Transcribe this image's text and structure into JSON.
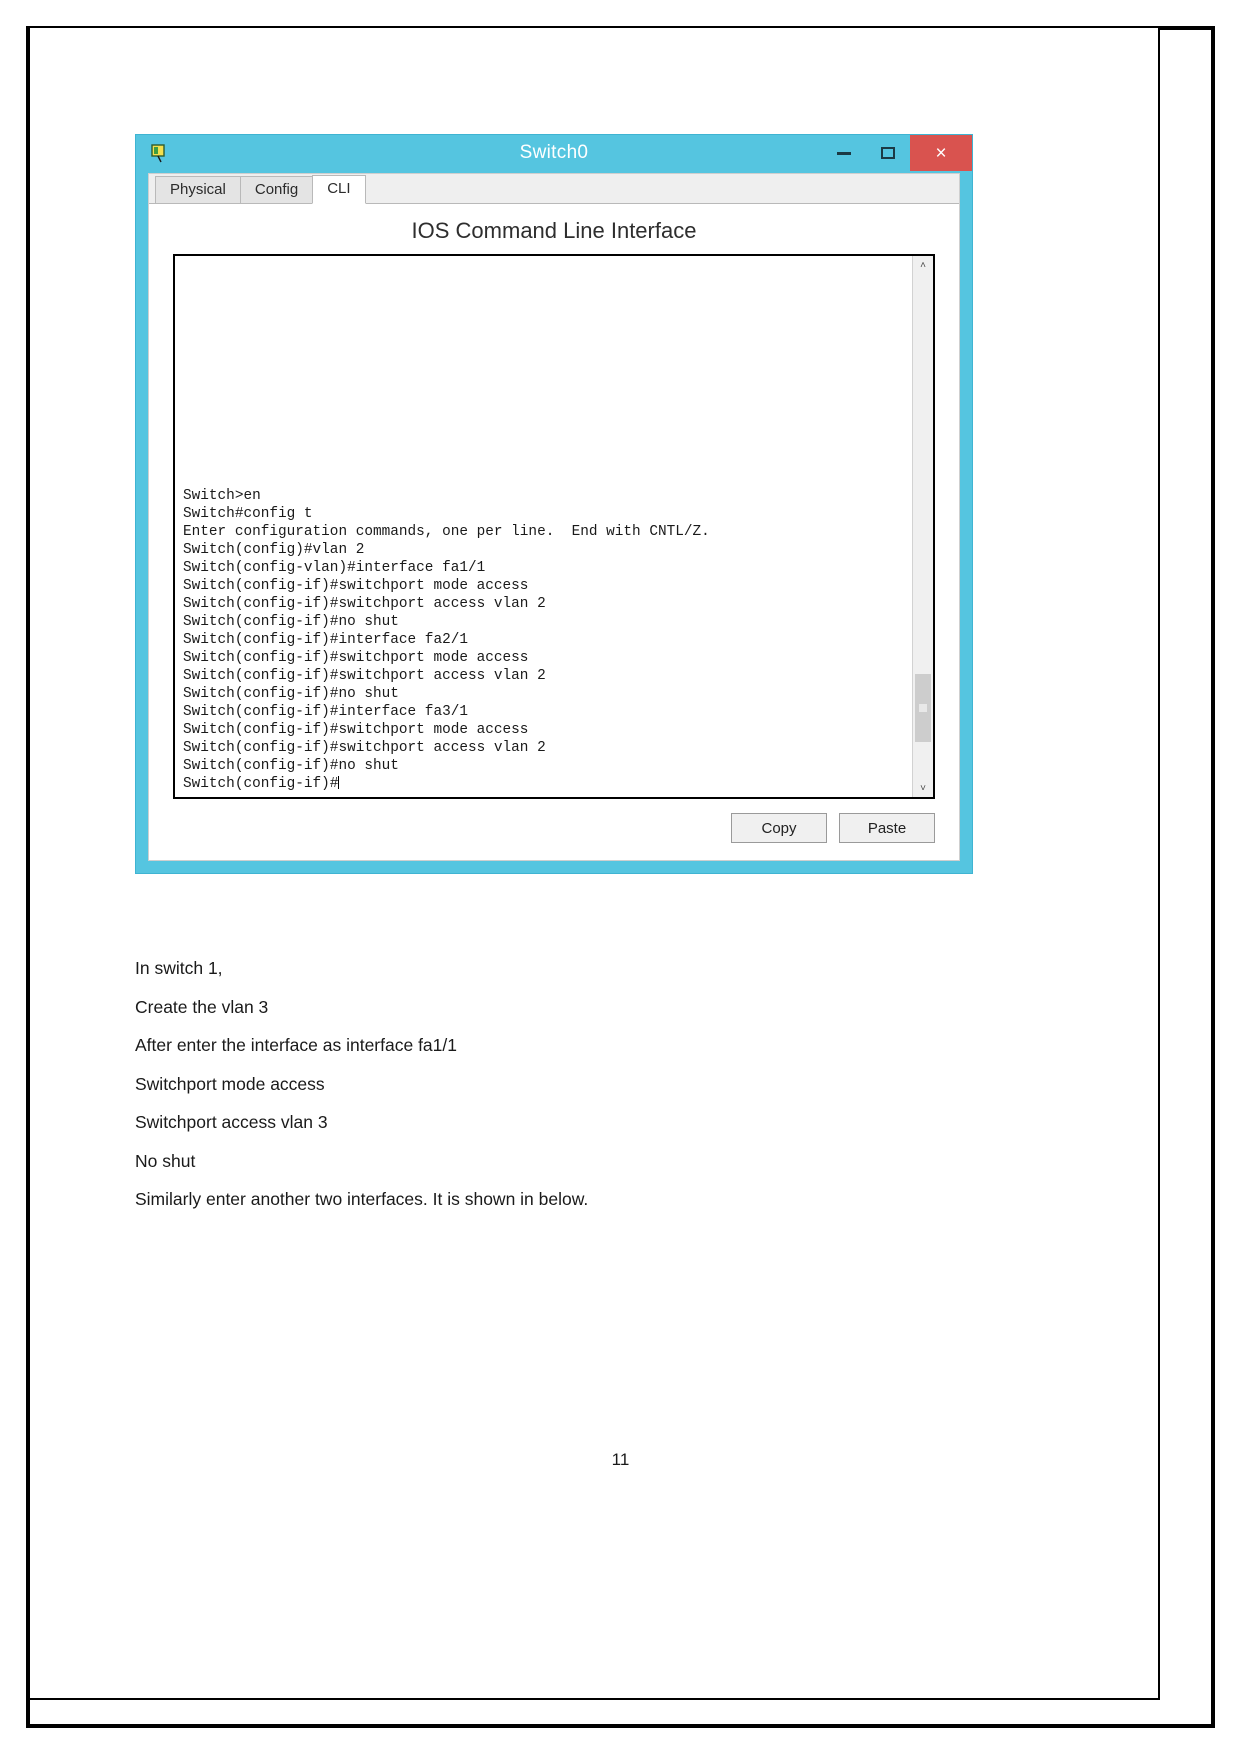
{
  "window": {
    "title": "Switch0",
    "icon": "packet-tracer-device-icon",
    "controls": {
      "minimize": "–",
      "maximize": "☐",
      "close": "×"
    },
    "accent_color": "#55c5e0",
    "close_color": "#d9534f"
  },
  "tabs": [
    {
      "label": "Physical",
      "active": false
    },
    {
      "label": "Config",
      "active": false
    },
    {
      "label": "CLI",
      "active": true
    }
  ],
  "cli": {
    "heading": "IOS Command Line Interface",
    "lines": [
      "Switch>en",
      "Switch#config t",
      "Enter configuration commands, one per line.  End with CNTL/Z.",
      "Switch(config)#vlan 2",
      "Switch(config-vlan)#interface fa1/1",
      "Switch(config-if)#switchport mode access",
      "Switch(config-if)#switchport access vlan 2",
      "Switch(config-if)#no shut",
      "Switch(config-if)#interface fa2/1",
      "Switch(config-if)#switchport mode access",
      "Switch(config-if)#switchport access vlan 2",
      "Switch(config-if)#no shut",
      "Switch(config-if)#interface fa3/1",
      "Switch(config-if)#switchport mode access",
      "Switch(config-if)#switchport access vlan 2",
      "Switch(config-if)#no shut"
    ],
    "prompt": "Switch(config-if)#",
    "scrollbar": {
      "up_arrow": "˄",
      "down_arrow": "˅"
    }
  },
  "buttons": {
    "copy": "Copy",
    "paste": "Paste"
  },
  "document": {
    "paragraphs": [
      "In switch 1,",
      "Create the vlan 3",
      "After enter the interface as interface fa1/1",
      "Switchport mode access",
      "Switchport access vlan 3",
      "No shut",
      "Similarly enter another two interfaces. It is shown in below."
    ],
    "page_number": "11"
  }
}
